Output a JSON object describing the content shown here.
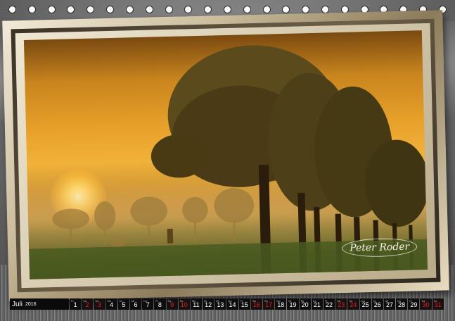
{
  "calendar": {
    "month": "Juli",
    "year": "2016",
    "days": [
      {
        "wd": "Fr",
        "n": "1",
        "red": false
      },
      {
        "wd": "Sa",
        "n": "2",
        "red": true
      },
      {
        "wd": "So",
        "n": "3",
        "red": true
      },
      {
        "wd": "Mo",
        "n": "4",
        "red": false
      },
      {
        "wd": "Di",
        "n": "5",
        "red": false
      },
      {
        "wd": "Mi",
        "n": "6",
        "red": false
      },
      {
        "wd": "Do",
        "n": "7",
        "red": false
      },
      {
        "wd": "Fr",
        "n": "8",
        "red": false
      },
      {
        "wd": "Sa",
        "n": "9",
        "red": true
      },
      {
        "wd": "So",
        "n": "10",
        "red": true
      },
      {
        "wd": "Mo",
        "n": "11",
        "red": false
      },
      {
        "wd": "Di",
        "n": "12",
        "red": false
      },
      {
        "wd": "Mi",
        "n": "13",
        "red": false
      },
      {
        "wd": "Do",
        "n": "14",
        "red": false
      },
      {
        "wd": "Fr",
        "n": "15",
        "red": false
      },
      {
        "wd": "Sa",
        "n": "16",
        "red": true
      },
      {
        "wd": "So",
        "n": "17",
        "red": true
      },
      {
        "wd": "Mo",
        "n": "18",
        "red": false
      },
      {
        "wd": "Di",
        "n": "19",
        "red": false
      },
      {
        "wd": "Mi",
        "n": "20",
        "red": false
      },
      {
        "wd": "Do",
        "n": "21",
        "red": false
      },
      {
        "wd": "Fr",
        "n": "22",
        "red": false
      },
      {
        "wd": "Sa",
        "n": "23",
        "red": true
      },
      {
        "wd": "So",
        "n": "24",
        "red": true
      },
      {
        "wd": "Mo",
        "n": "25",
        "red": false
      },
      {
        "wd": "Di",
        "n": "26",
        "red": false
      },
      {
        "wd": "Mi",
        "n": "27",
        "red": false
      },
      {
        "wd": "Do",
        "n": "28",
        "red": false
      },
      {
        "wd": "Fr",
        "n": "29",
        "red": false
      },
      {
        "wd": "Sa",
        "n": "30",
        "red": true
      },
      {
        "wd": "So",
        "n": "31",
        "red": true
      }
    ]
  },
  "photo": {
    "signature": "Peter Roder",
    "colors": {
      "sky_top": "#7a4a10",
      "sky_mid": "#e8a12a",
      "field": "#3e4a18",
      "tree": "#3a2a10"
    }
  },
  "binding": {
    "ring_count": 23
  }
}
